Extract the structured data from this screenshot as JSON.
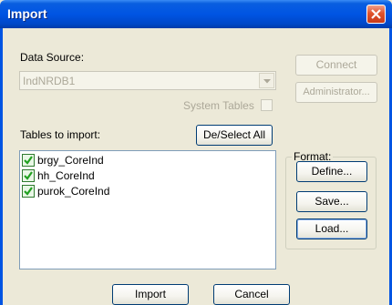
{
  "window": {
    "title": "Import"
  },
  "data_source": {
    "label": "Data Source:",
    "selected": "IndNRDB1",
    "system_tables_label": "System Tables",
    "system_tables_checked": false
  },
  "buttons": {
    "connect": "Connect",
    "administrator": "Administrator...",
    "deselect_all": "De/Select All",
    "define": "Define...",
    "save": "Save...",
    "load": "Load...",
    "import": "Import",
    "cancel": "Cancel"
  },
  "tables": {
    "label": "Tables to import:",
    "items": [
      {
        "name": "brgy_CoreInd",
        "checked": true
      },
      {
        "name": "hh_CoreInd",
        "checked": true
      },
      {
        "name": "purok_CoreInd",
        "checked": true
      }
    ]
  },
  "format": {
    "label": "Format:"
  },
  "icons": {
    "close": "close-icon",
    "dropdown": "chevron-down-icon",
    "check": "checkmark-icon"
  },
  "colors": {
    "titlebar": "#0054e3",
    "dialog_bg": "#ece9d8",
    "close_button": "#e0532c",
    "disabled_text": "#aca899"
  }
}
